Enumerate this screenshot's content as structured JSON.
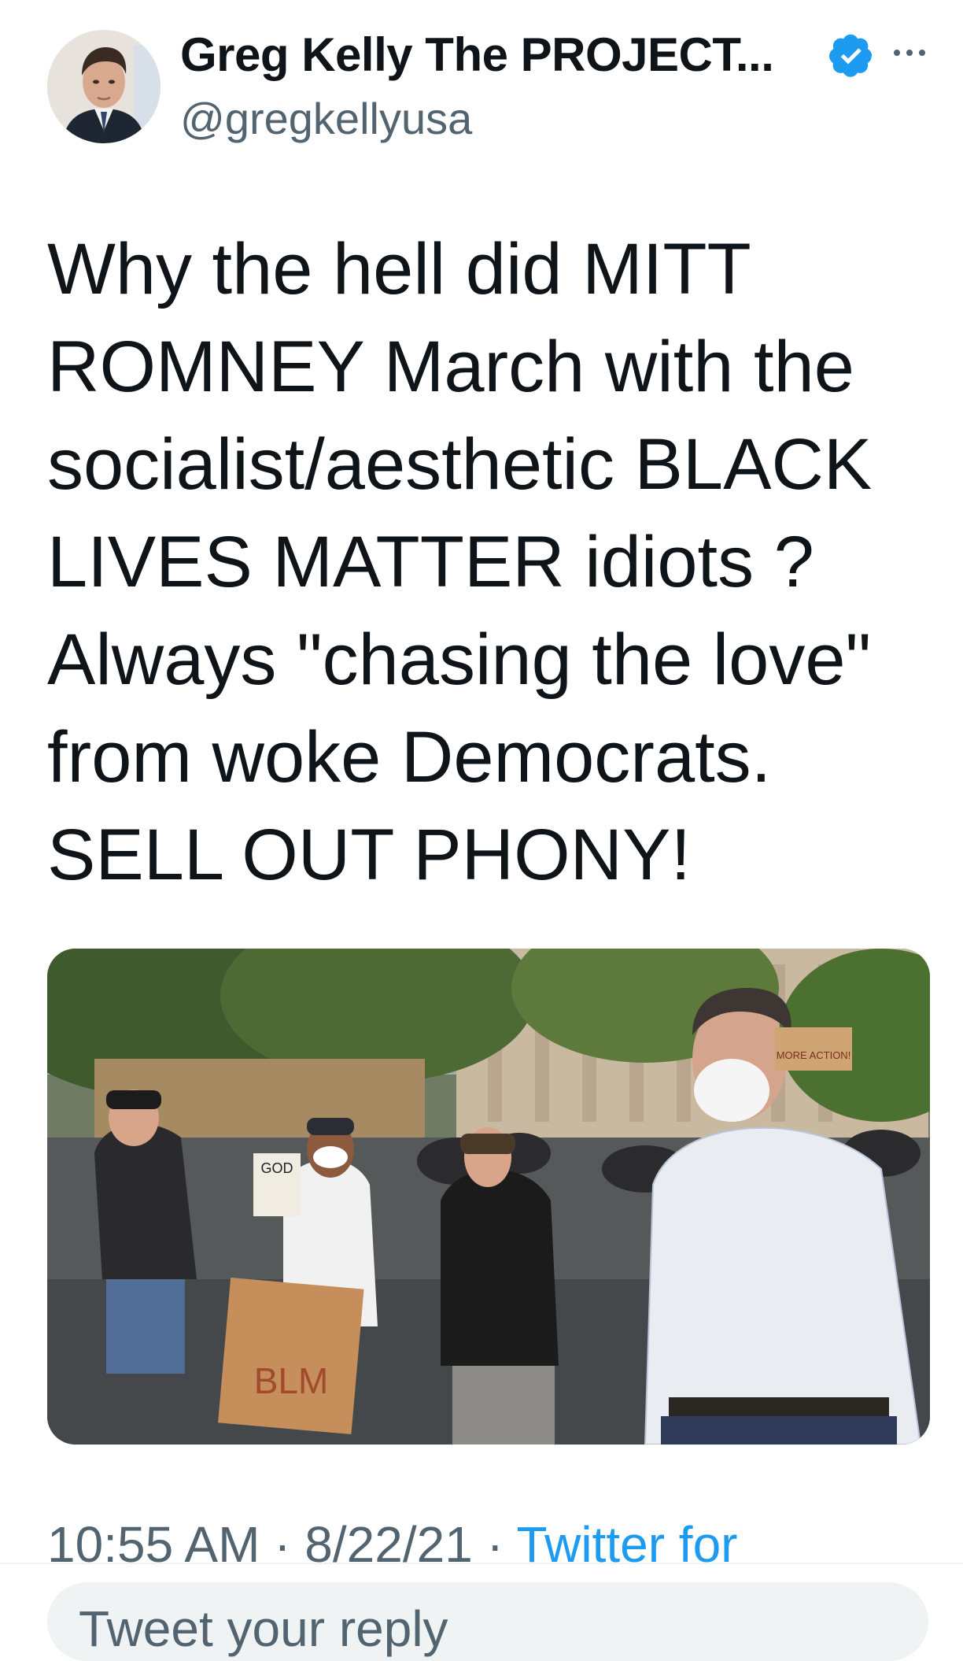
{
  "tweet": {
    "author": {
      "display_name": "Greg Kelly The PROJECT...",
      "handle": "@gregkellyusa",
      "verified": true,
      "avatar_icon": "profile-photo"
    },
    "menu_icon": "more-dots-icon",
    "text_lines": [
      "Why the hell did MITT",
      "ROMNEY March with the",
      "socialist/aesthetic BLACK",
      "LIVES MATTER idiots ?",
      "Always \"chasing the love\"",
      "from woke Democrats.",
      "SELL OUT PHONY!"
    ],
    "media": {
      "sign_god": "GOD",
      "sign_blm": "BLM",
      "sign_more_action": "MORE ACTION!"
    },
    "meta": {
      "time": "10:55 AM",
      "separator": " · ",
      "date": "8/22/21",
      "source": "Twitter for"
    }
  },
  "reply": {
    "placeholder": "Tweet your reply"
  },
  "colors": {
    "text": "#0f1419",
    "secondary": "#536471",
    "accent": "#1d9bf0",
    "divider": "#eff3f4"
  }
}
